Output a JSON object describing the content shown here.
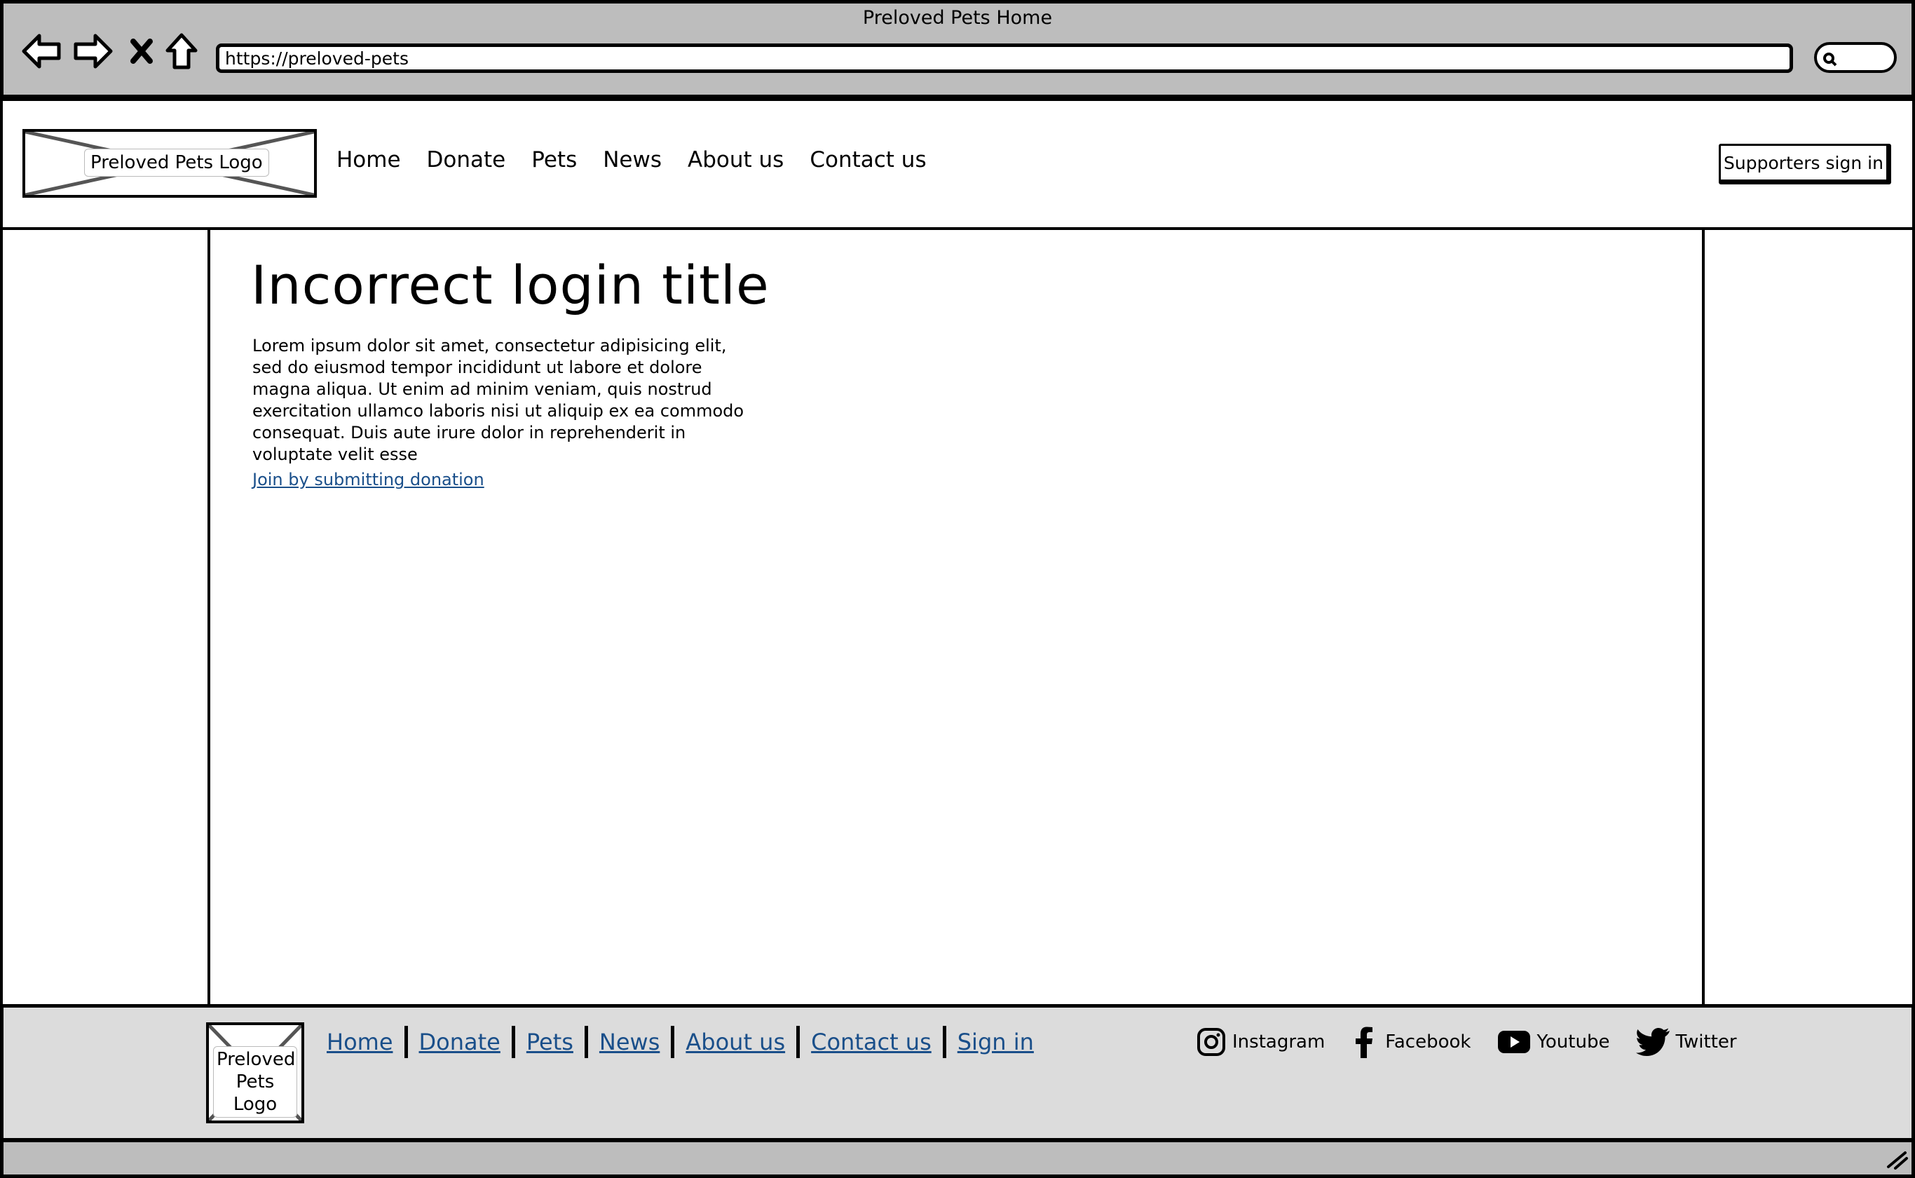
{
  "browser": {
    "window_title": "Preloved Pets Home",
    "url": "https://preloved-pets"
  },
  "header": {
    "logo_label": "Preloved Pets Logo",
    "nav": [
      "Home",
      "Donate",
      "Pets",
      "News",
      "About us",
      "Contact us"
    ],
    "signin_label": "Supporters sign in"
  },
  "main": {
    "title": "Incorrect login title",
    "body": "Lorem ipsum dolor sit amet, consectetur adipisicing elit, sed do eiusmod tempor incididunt ut labore et dolore magna aliqua. Ut enim ad minim veniam, quis nostrud exercitation ullamco laboris nisi ut aliquip ex ea commodo consequat. Duis aute irure dolor in reprehenderit in voluptate velit esse",
    "link": "Join by submitting donation"
  },
  "footer": {
    "logo_label": "Preloved Pets Logo",
    "nav": [
      "Home",
      "Donate",
      "Pets",
      "News",
      "About us",
      "Contact us",
      "Sign in"
    ],
    "social": [
      "Instagram",
      "Facebook",
      "Youtube",
      "Twitter"
    ]
  },
  "colors": {
    "chrome": "#bdbdbd",
    "footer": "#dcdcdc",
    "link": "#1a4f8a"
  }
}
